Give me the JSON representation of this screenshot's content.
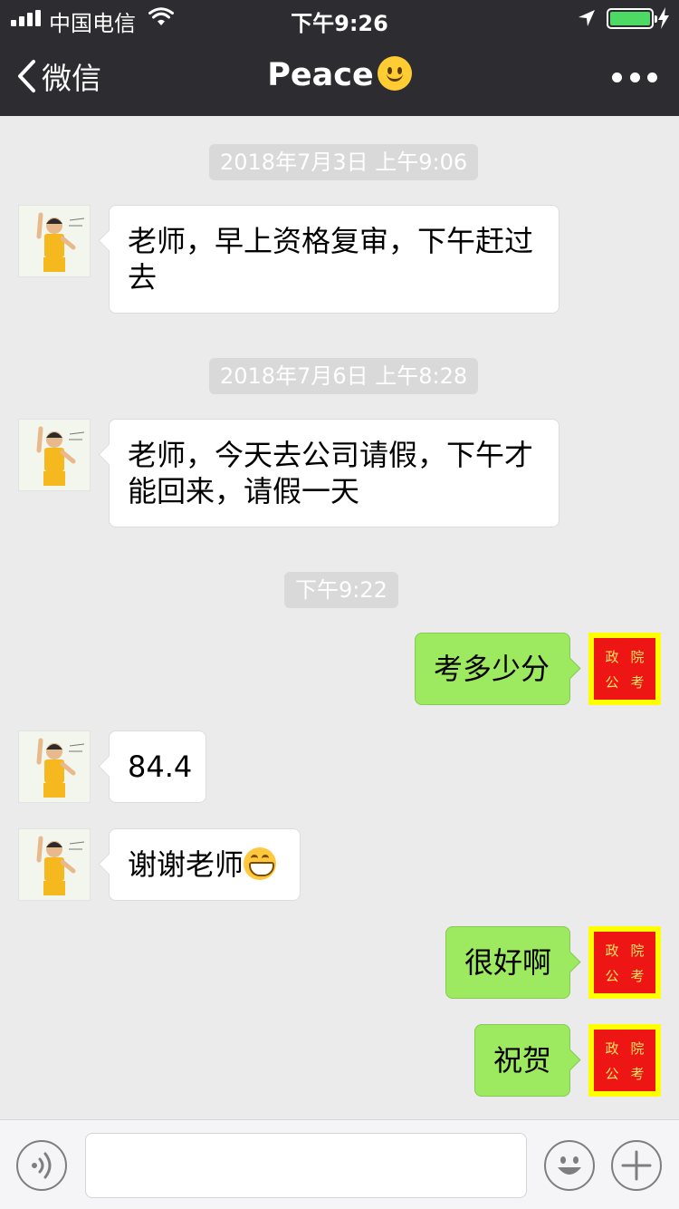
{
  "status_bar": {
    "carrier": "中国电信",
    "time": "下午9:26"
  },
  "nav": {
    "back_label": "微信",
    "title": "Peace",
    "title_emoji": "slightly-smiling-face"
  },
  "messages": [
    {
      "type": "timestamp",
      "text": "2018年7月3日 上午9:06"
    },
    {
      "type": "message",
      "side": "left",
      "text": "老师，早上资格复审，下午赶过去"
    },
    {
      "type": "timestamp",
      "text": "2018年7月6日 上午8:28"
    },
    {
      "type": "message",
      "side": "left",
      "text": "老师，今天去公司请假，下午才能回来，请假一天"
    },
    {
      "type": "timestamp",
      "text": "下午9:22"
    },
    {
      "type": "message",
      "side": "right",
      "text": "考多少分"
    },
    {
      "type": "message",
      "side": "left",
      "text": "84.4"
    },
    {
      "type": "message",
      "side": "left",
      "text": "谢谢老师",
      "emoji": "grinning-face"
    },
    {
      "type": "message",
      "side": "right",
      "text": "很好啊"
    },
    {
      "type": "message",
      "side": "right",
      "text": "祝贺"
    }
  ],
  "self_avatar_text": [
    "政",
    "院",
    "公",
    "考"
  ],
  "colors": {
    "nav_bg": "#2d2c31",
    "chat_bg": "#ebebeb",
    "sent_bubble": "#9de95f",
    "received_bubble": "#ffffff",
    "battery": "#4cd964"
  }
}
